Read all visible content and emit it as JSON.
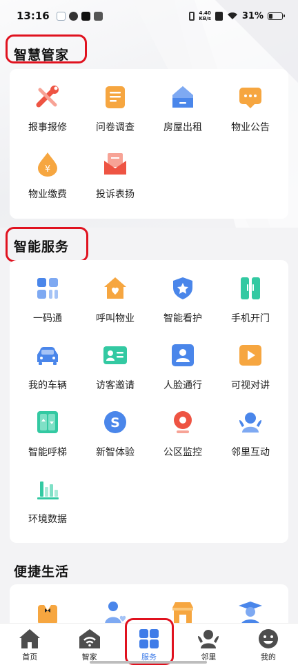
{
  "status": {
    "time": "13:16",
    "net_speed_value": "4.40",
    "net_speed_unit": "KB/s",
    "battery": "31%"
  },
  "sections": {
    "housekeeper": {
      "title": "智慧管家",
      "items": [
        {
          "label": "报事报修",
          "icon": "wrench-icon"
        },
        {
          "label": "问卷调查",
          "icon": "document-icon"
        },
        {
          "label": "房屋出租",
          "icon": "house-icon"
        },
        {
          "label": "物业公告",
          "icon": "message-icon"
        },
        {
          "label": "物业缴费",
          "icon": "yuan-drop-icon"
        },
        {
          "label": "投诉表扬",
          "icon": "envelope-icon"
        }
      ]
    },
    "smart_services": {
      "title": "智能服务",
      "items": [
        {
          "label": "一码通",
          "icon": "grid-code-icon"
        },
        {
          "label": "呼叫物业",
          "icon": "heart-house-icon"
        },
        {
          "label": "智能看护",
          "icon": "shield-star-icon"
        },
        {
          "label": "手机开门",
          "icon": "door-icon"
        },
        {
          "label": "我的车辆",
          "icon": "car-icon"
        },
        {
          "label": "访客邀请",
          "icon": "id-card-icon"
        },
        {
          "label": "人脸通行",
          "icon": "face-id-icon"
        },
        {
          "label": "可视对讲",
          "icon": "play-video-icon"
        },
        {
          "label": "智能呼梯",
          "icon": "elevator-icon"
        },
        {
          "label": "新智体验",
          "icon": "s-circle-icon"
        },
        {
          "label": "公区监控",
          "icon": "camera-icon"
        },
        {
          "label": "邻里互动",
          "icon": "neighbor-icon"
        },
        {
          "label": "环境数据",
          "icon": "bar-chart-icon"
        }
      ]
    },
    "convenient_life": {
      "title": "便捷生活"
    }
  },
  "nav": {
    "items": [
      {
        "label": "首页",
        "icon": "home-icon"
      },
      {
        "label": "智家",
        "icon": "wifi-house-icon"
      },
      {
        "label": "服务",
        "icon": "service-grid-icon"
      },
      {
        "label": "邻里",
        "icon": "neighbor-icon"
      },
      {
        "label": "我的",
        "icon": "smile-face-icon"
      }
    ],
    "active": "服务"
  },
  "colors": {
    "accent_blue": "#3f7ce8",
    "highlight_red": "#e0121f",
    "orange": "#f6a640",
    "red": "#ee5443",
    "green": "#33c9a2"
  }
}
